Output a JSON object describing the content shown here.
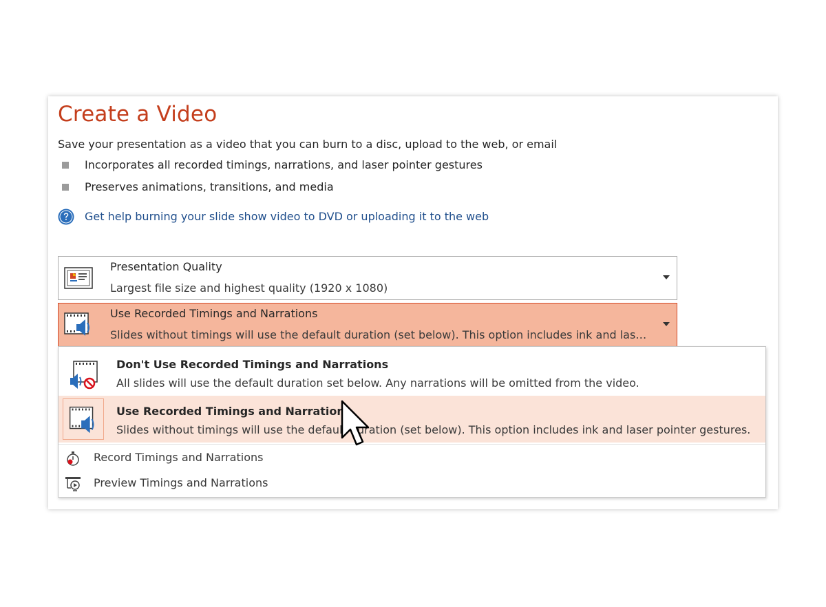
{
  "page": {
    "title": "Create a Video",
    "subtitle": "Save your presentation as a video that you can burn to a disc, upload to the web, or email",
    "bullets": [
      "Incorporates all recorded timings, narrations, and laser pointer gestures",
      "Preserves animations, transitions, and media"
    ],
    "help_link": "Get help burning your slide show video to DVD or uploading it to the web"
  },
  "quality_dropdown": {
    "title": "Presentation Quality",
    "description": "Largest file size and highest quality (1920 x 1080)",
    "icon": "presentation-quality-icon"
  },
  "timings_dropdown": {
    "title": "Use Recorded Timings and Narrations",
    "description": "Slides without timings will use the default duration (set below). This option includes ink and las…",
    "icon": "film-speaker-icon"
  },
  "menu": {
    "options": [
      {
        "title": "Don't Use Recorded Timings and Narrations",
        "description": "All slides will use the default duration set below. Any narrations will be omitted from the video.",
        "icon": "film-speaker-muted-icon",
        "selected": false
      },
      {
        "title": "Use Recorded Timings and Narrations",
        "description": "Slides without timings will use the default duration (set below). This option includes ink and laser pointer gestures.",
        "icon": "film-speaker-icon",
        "selected": true
      }
    ],
    "commands": [
      {
        "label": "Record Timings and Narrations",
        "icon": "record-timer-icon"
      },
      {
        "label": "Preview Timings and Narrations",
        "icon": "preview-screen-icon"
      }
    ]
  },
  "colors": {
    "title_red": "#c43e1c",
    "link_blue": "#1f4e8c",
    "active_dropdown_bg": "#f5b69c",
    "active_dropdown_border": "#d24726",
    "selected_option_bg": "#fbe3d8"
  }
}
